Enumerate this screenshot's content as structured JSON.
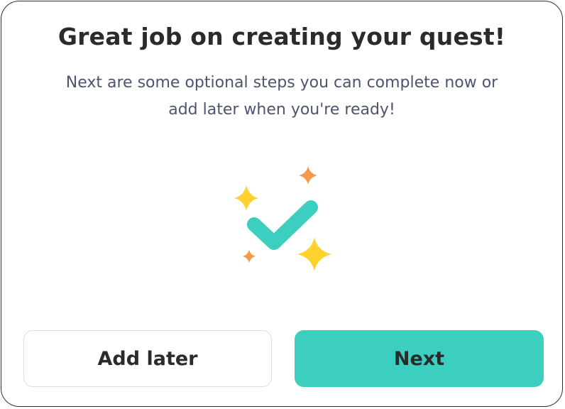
{
  "dialog": {
    "title": "Great job on creating your quest!",
    "subtitle_line1": "Next are some optional steps you can complete now or",
    "subtitle_line2": "add later when you're ready!"
  },
  "illustration": {
    "icon": "sparkle-checkmark-icon",
    "check_color": "#3ccfc0",
    "sparkle_yellow": "#ffd230",
    "sparkle_orange": "#f59a4a"
  },
  "buttons": {
    "add_later_label": "Add later",
    "next_label": "Next"
  },
  "colors": {
    "primary": "#3ccfc0",
    "title_text": "#2b2b2b",
    "subtitle_text": "#4d5470",
    "secondary_border": "#dcdde8"
  }
}
